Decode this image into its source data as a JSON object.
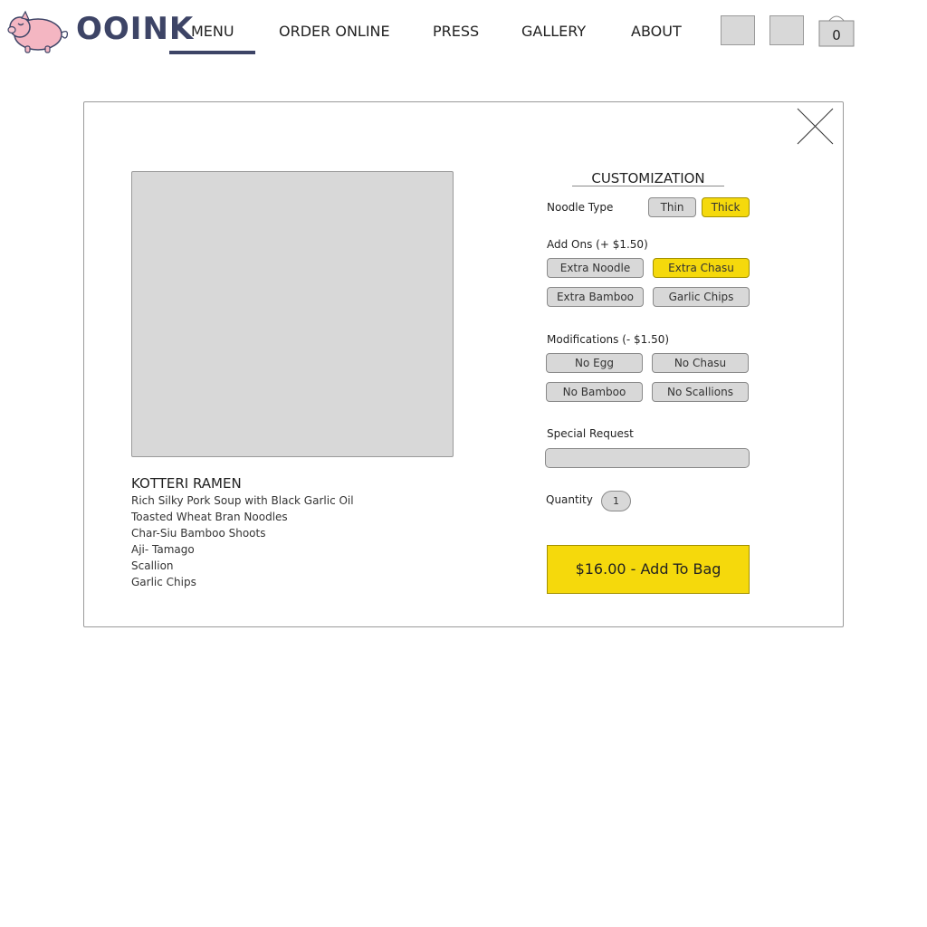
{
  "header": {
    "brand": "OOINK",
    "nav": [
      {
        "label": "MENU",
        "active": true
      },
      {
        "label": "ORDER ONLINE"
      },
      {
        "label": "PRESS"
      },
      {
        "label": "GALLERY"
      },
      {
        "label": "ABOUT"
      }
    ],
    "cart_count": "0"
  },
  "modal": {
    "item": {
      "title": "KOTTERI RAMEN",
      "description": [
        "Rich Silky Pork Soup with Black Garlic Oil",
        "Toasted Wheat Bran Noodles",
        "Char-Siu Bamboo Shoots",
        "Aji- Tamago",
        "Scallion",
        "Garlic Chips"
      ]
    },
    "customization": {
      "title": "CUSTOMIZATION",
      "noodle_type": {
        "label": "Noodle Type",
        "options": [
          {
            "label": "Thin",
            "selected": false
          },
          {
            "label": "Thick",
            "selected": true
          }
        ]
      },
      "add_ons": {
        "label": "Add Ons (+ $1.50)",
        "options": [
          {
            "label": "Extra Noodle",
            "selected": false
          },
          {
            "label": "Extra Chasu",
            "selected": true
          },
          {
            "label": "Extra Bamboo",
            "selected": false
          },
          {
            "label": "Garlic Chips",
            "selected": false
          }
        ]
      },
      "modifications": {
        "label": "Modifications (- $1.50)",
        "options": [
          {
            "label": "No Egg",
            "selected": false
          },
          {
            "label": "No Chasu",
            "selected": false
          },
          {
            "label": "No Bamboo",
            "selected": false
          },
          {
            "label": "No Scallions",
            "selected": false
          }
        ]
      },
      "special_request": {
        "label": "Special Request",
        "value": ""
      },
      "quantity": {
        "label": "Quantity",
        "value": "1"
      },
      "add_to_bag": "$16.00 - Add To Bag"
    }
  },
  "colors": {
    "accent_yellow": "#f5d90c",
    "nav_underline": "#3d4466",
    "placeholder_gray": "#d8d8d8",
    "logo_pink": "#f4b6c2"
  },
  "icons": {
    "logo": "pig-icon",
    "close": "close-icon",
    "cart": "shopping-bag-icon"
  }
}
